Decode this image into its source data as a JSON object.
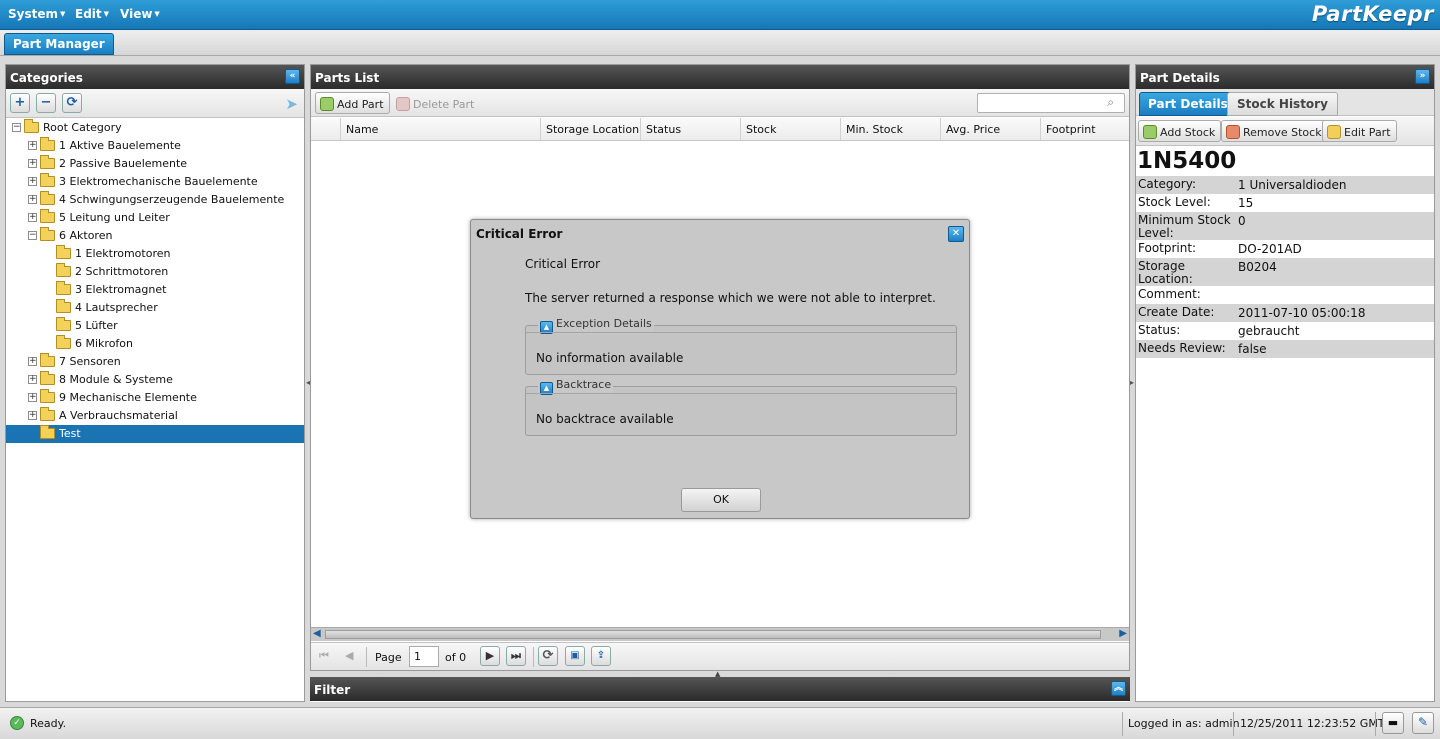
{
  "app": {
    "brand": "PartKeepr"
  },
  "menubar": [
    {
      "label": "System"
    },
    {
      "label": "Edit"
    },
    {
      "label": "View"
    }
  ],
  "tabs": {
    "part_manager": "Part Manager"
  },
  "categories": {
    "title": "Categories",
    "tree": [
      {
        "label": "Root Category",
        "level": 0,
        "expander": "minus",
        "open": true
      },
      {
        "label": "1 Aktive Bauelemente",
        "level": 1,
        "expander": "plus"
      },
      {
        "label": "2 Passive Bauelemente",
        "level": 1,
        "expander": "plus"
      },
      {
        "label": "3 Elektromechanische Bauelemente",
        "level": 1,
        "expander": "plus"
      },
      {
        "label": "4 Schwingungserzeugende Bauelemente",
        "level": 1,
        "expander": "plus"
      },
      {
        "label": "5 Leitung und Leiter",
        "level": 1,
        "expander": "plus"
      },
      {
        "label": "6 Aktoren",
        "level": 1,
        "expander": "minus",
        "open": true
      },
      {
        "label": "1 Elektromotoren",
        "level": 2,
        "expander": ""
      },
      {
        "label": "2 Schrittmotoren",
        "level": 2,
        "expander": ""
      },
      {
        "label": "3 Elektromagnet",
        "level": 2,
        "expander": ""
      },
      {
        "label": "4 Lautsprecher",
        "level": 2,
        "expander": ""
      },
      {
        "label": "5 Lüfter",
        "level": 2,
        "expander": ""
      },
      {
        "label": "6 Mikrofon",
        "level": 2,
        "expander": ""
      },
      {
        "label": "7 Sensoren",
        "level": 1,
        "expander": "plus"
      },
      {
        "label": "8 Module & Systeme",
        "level": 1,
        "expander": "plus"
      },
      {
        "label": "9 Mechanische Elemente",
        "level": 1,
        "expander": "plus"
      },
      {
        "label": "A Verbrauchsmaterial",
        "level": 1,
        "expander": "plus"
      },
      {
        "label": "Test",
        "level": 1,
        "expander": "",
        "selected": true
      }
    ]
  },
  "parts_list": {
    "title": "Parts List",
    "add_part": "Add Part",
    "delete_part": "Delete Part",
    "search_placeholder": "",
    "columns": [
      "Name",
      "Storage Location",
      "Status",
      "Stock",
      "Min. Stock",
      "Avg. Price",
      "Footprint"
    ],
    "pager": {
      "page_label": "Page",
      "page_value": "1",
      "of_label": "of 0"
    }
  },
  "filter": {
    "title": "Filter"
  },
  "part_details": {
    "title": "Part Details",
    "tabs": [
      "Part Details",
      "Stock History"
    ],
    "add_stock": "Add Stock",
    "remove_stock": "Remove Stock",
    "edit_part": "Edit Part",
    "part_name": "1N5400",
    "fields": [
      {
        "key": "Category:",
        "value": "1 Universaldioden"
      },
      {
        "key": "Stock Level:",
        "value": "15"
      },
      {
        "key": "Minimum Stock Level:",
        "value": "0"
      },
      {
        "key": "Footprint:",
        "value": "DO-201AD"
      },
      {
        "key": "Storage Location:",
        "value": "B0204"
      },
      {
        "key": "Comment:",
        "value": ""
      },
      {
        "key": "Create Date:",
        "value": "2011-07-10 05:00:18"
      },
      {
        "key": "Status:",
        "value": "gebraucht"
      },
      {
        "key": "Needs Review:",
        "value": "false"
      }
    ]
  },
  "dialog": {
    "title": "Critical Error",
    "heading": "Critical Error",
    "message": "The server returned a response which we were not able to interpret.",
    "exception_legend": "Exception Details",
    "exception_text": "No information available",
    "backtrace_legend": "Backtrace",
    "backtrace_text": "No backtrace available",
    "ok": "OK"
  },
  "statusbar": {
    "status": "Ready.",
    "logged_in": "Logged in as: admin",
    "datetime": "12/25/2011 12:23:52 GMT"
  },
  "colors": {
    "accent": "#1a74b4",
    "header_dark": "#2b2b2b"
  }
}
